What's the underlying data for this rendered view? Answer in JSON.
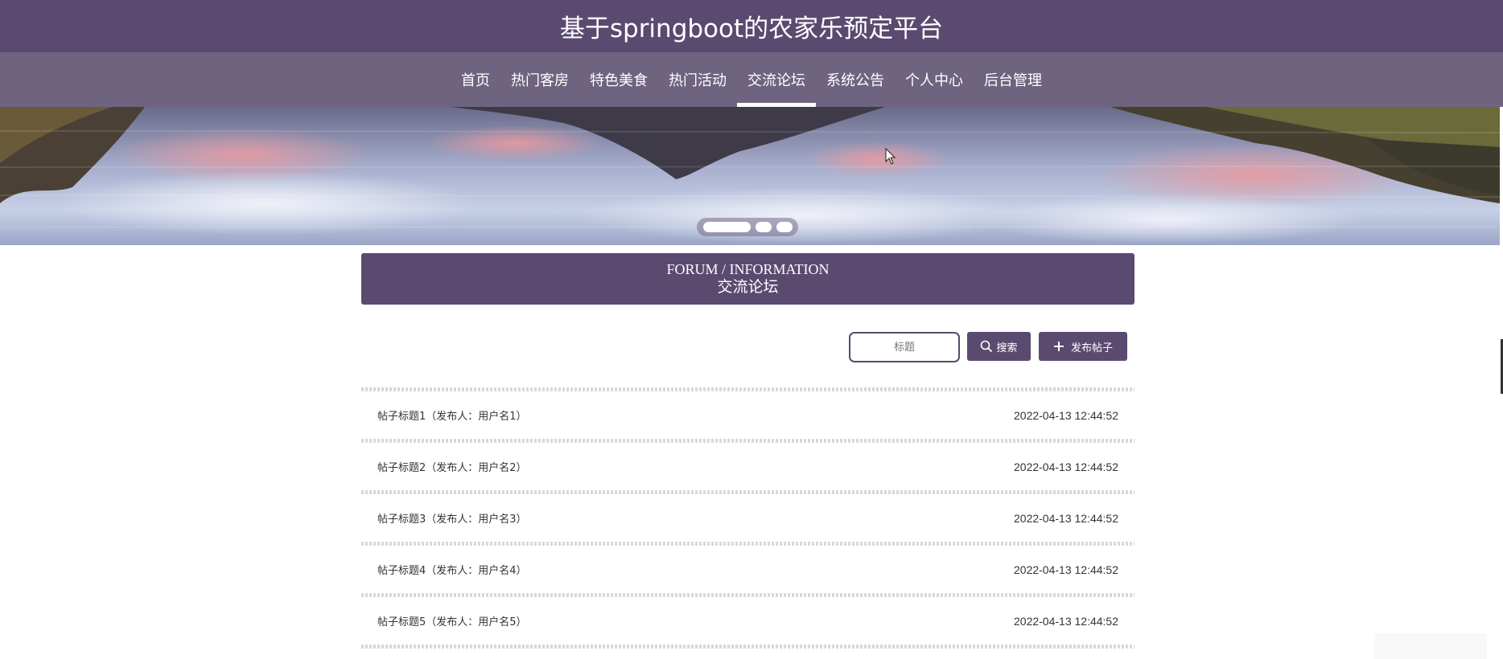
{
  "header": {
    "title": "基于springboot的农家乐预定平台"
  },
  "nav": {
    "items": [
      {
        "label": "首页"
      },
      {
        "label": "热门客房"
      },
      {
        "label": "特色美食"
      },
      {
        "label": "热门活动"
      },
      {
        "label": "交流论坛"
      },
      {
        "label": "系统公告"
      },
      {
        "label": "个人中心"
      },
      {
        "label": "后台管理"
      }
    ],
    "active_index": 4
  },
  "banner": {
    "slide_count": 3,
    "active_slide": 1
  },
  "section": {
    "title_en": "FORUM / INFORMATION",
    "title_cn": "交流论坛"
  },
  "search": {
    "placeholder": "标题",
    "value": "",
    "search_label": "搜索",
    "post_label": "发布帖子"
  },
  "posts": [
    {
      "title": "帖子标题1（发布人：用户名1）",
      "date": "2022-04-13 12:44:52"
    },
    {
      "title": "帖子标题2（发布人：用户名2）",
      "date": "2022-04-13 12:44:52"
    },
    {
      "title": "帖子标题3（发布人：用户名3）",
      "date": "2022-04-13 12:44:52"
    },
    {
      "title": "帖子标题4（发布人：用户名4）",
      "date": "2022-04-13 12:44:52"
    },
    {
      "title": "帖子标题5（发布人：用户名5）",
      "date": "2022-04-13 12:44:52"
    }
  ],
  "colors": {
    "primary": "#5a4a70",
    "nav_bg": "#6e6480",
    "text": "#333333"
  },
  "icons": {
    "search": "search-icon",
    "add": "plus-icon",
    "cursor": "mouse-cursor-icon"
  }
}
